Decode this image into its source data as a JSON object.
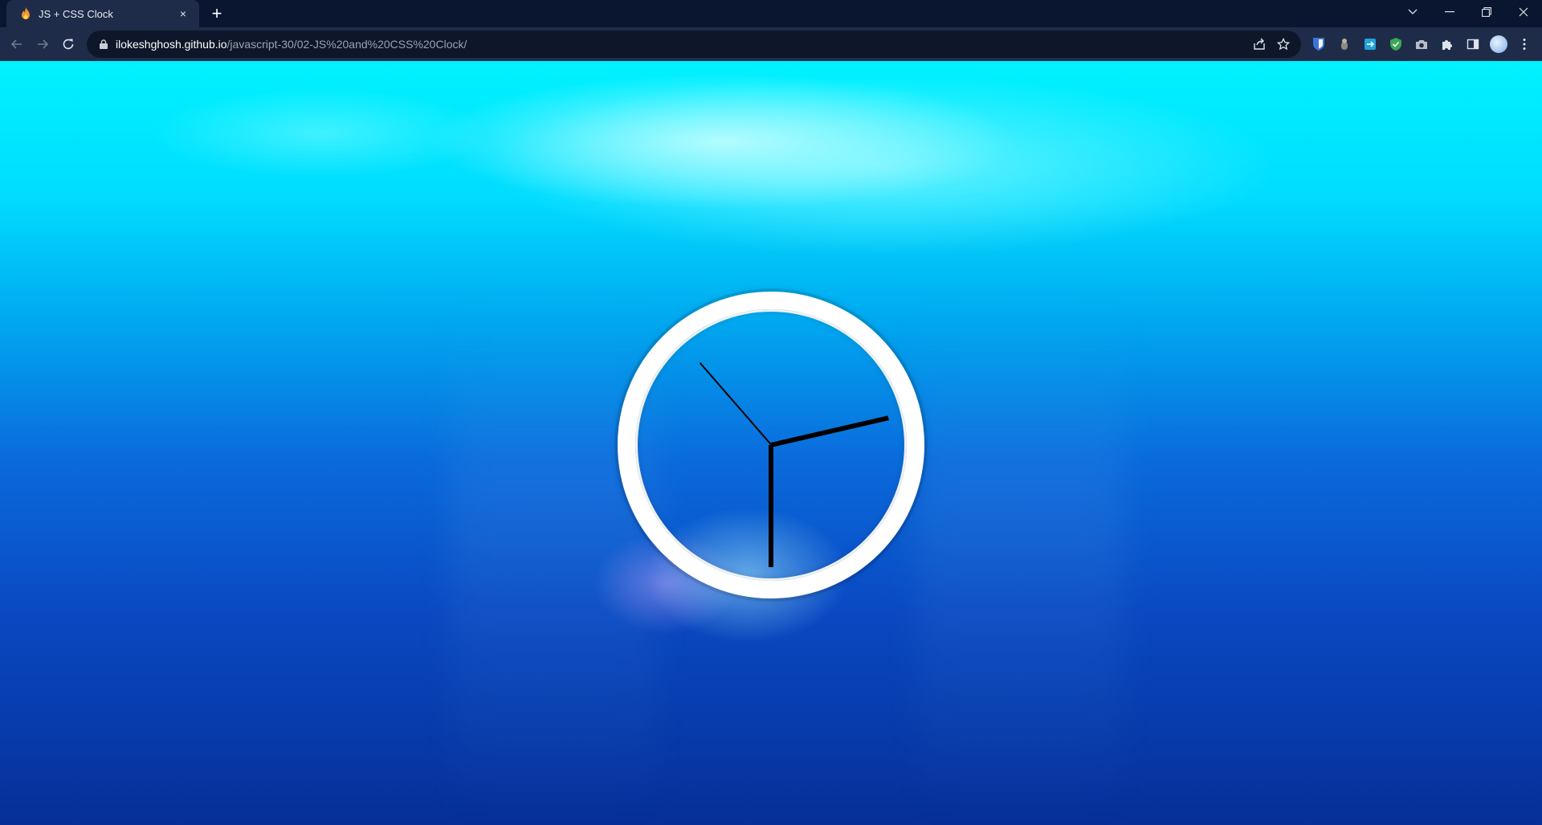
{
  "browser": {
    "tab": {
      "title": "JS + CSS Clock",
      "close_glyph": "×",
      "favicon": "flame-icon"
    },
    "new_tab_glyph": "+",
    "address": {
      "host": "ilokeshghosh.github.io",
      "path": "/javascript-30/02-JS%20and%20CSS%20Clock/"
    },
    "icons": [
      "back-arrow-icon",
      "forward-arrow-icon",
      "reload-icon",
      "lock-icon",
      "share-icon",
      "star-icon",
      "bitwarden-icon",
      "extension-icon",
      "translate-icon",
      "shield-icon",
      "camera-icon",
      "puzzle-icon",
      "side-panel-icon",
      "profile-avatar",
      "menu-icon",
      "tab-search-icon",
      "minimize-icon",
      "restore-icon",
      "close-window-icon"
    ]
  },
  "clock": {
    "hour_hand_deg": 90,
    "minute_hand_deg": -13,
    "second_hand_deg": -131,
    "colors": {
      "ring": "#ffffff",
      "hands": "#000000"
    }
  }
}
